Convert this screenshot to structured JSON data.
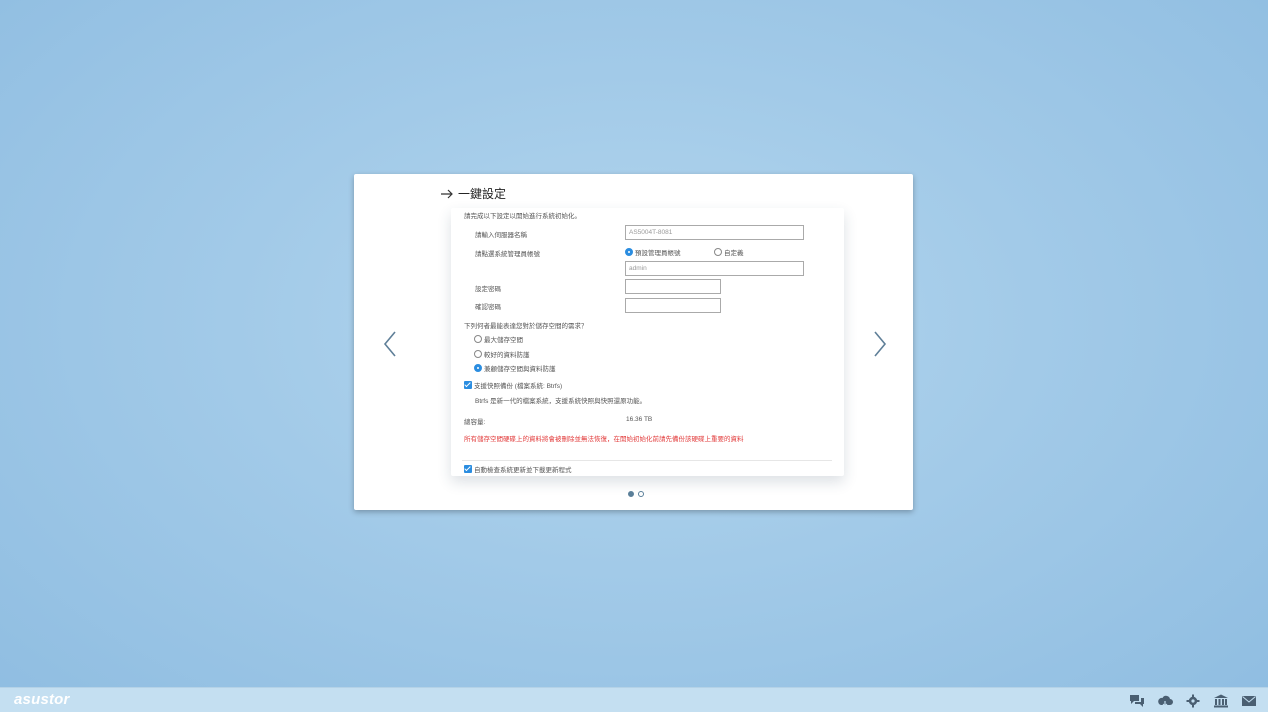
{
  "dialog": {
    "title": "一鍵設定",
    "intro": "請完成以下設定以開始進行系統初始化。",
    "server_name_label": "請輸入伺服器名稱",
    "server_name_value": "AS5004T-8081",
    "admin_choice_label": "請點選系統管理員帳號",
    "admin_option_default": "預設管理員帳號",
    "admin_option_custom": "自定義",
    "admin_username_value": "admin",
    "password_label": "設定密碼",
    "confirm_password_label": "確認密碼",
    "storage_question": "下列何者最能表達您對於儲存空間的需求？",
    "storage_options": [
      "最大儲存空間",
      "較好的資料防護",
      "兼顧儲存空間與資料防護"
    ],
    "storage_selected_index": 2,
    "btrfs_checkbox_label": "支援快照備份 (檔案系統: Btrfs)",
    "btrfs_description": "Btrfs 是新一代的檔案系統，支援系統快照與快照還原功能。",
    "capacity_label": "總容量:",
    "capacity_value": "16.36 TB",
    "warning_text": "所有儲存空間硬碟上的資料將會被刪除並無法恢復，在開始初始化前請先備份該硬碟上重要的資料",
    "auto_update_label": "自動檢查系統更新並下載更新程式",
    "page_dots": 2,
    "page_current": 0
  },
  "taskbar": {
    "logo": "asustor",
    "icons": [
      "chat-icon",
      "cloud-icon",
      "gear-icon",
      "bank-icon",
      "mail-icon"
    ]
  },
  "colors": {
    "accent": "#2b8de0",
    "warning": "#e23b3b",
    "background": "#a2cae8"
  }
}
